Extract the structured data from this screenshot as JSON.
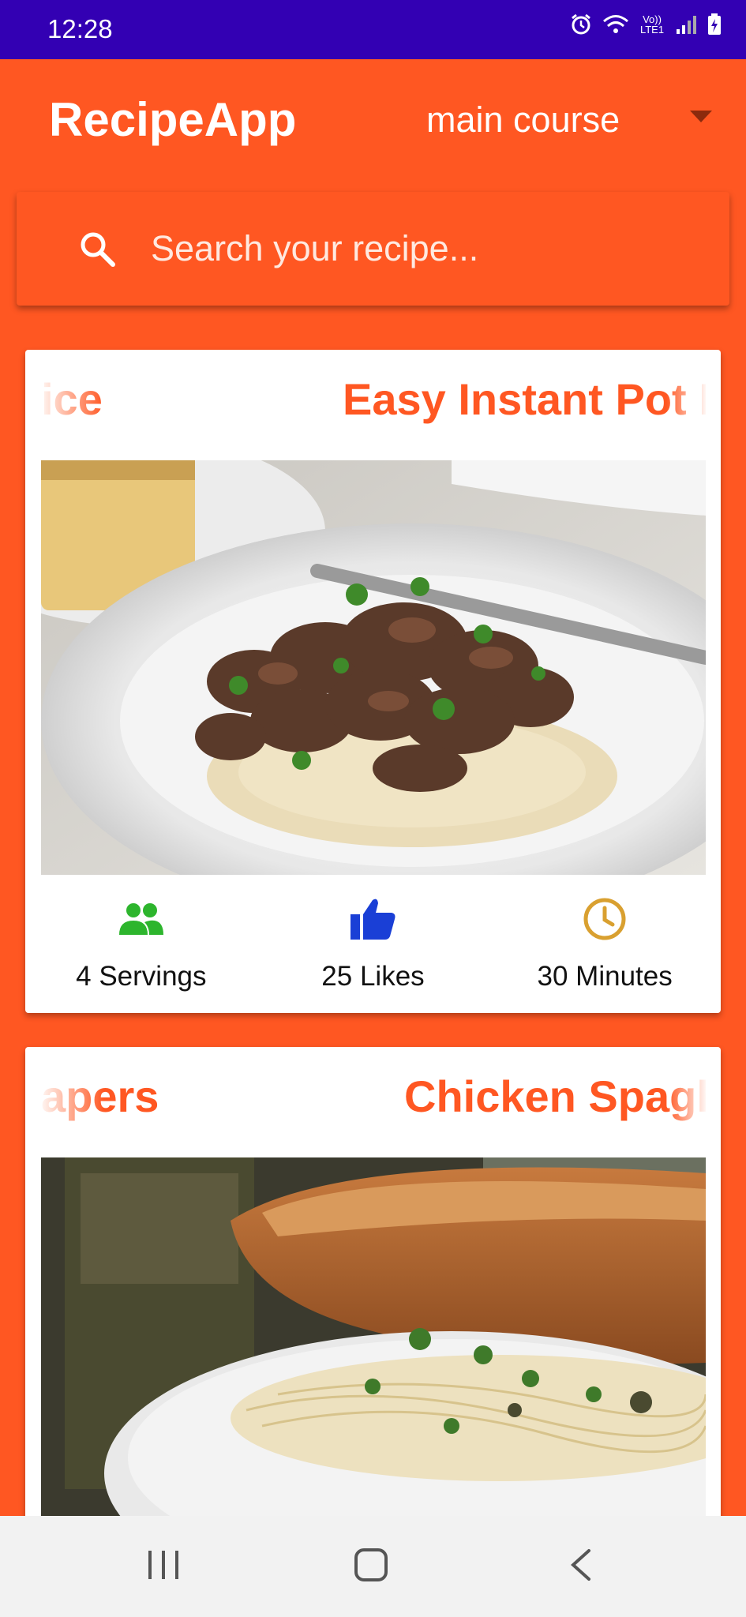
{
  "status_bar": {
    "time": "12:28",
    "network_label": "Vo)) LTE1"
  },
  "app_bar": {
    "title": "RecipeApp",
    "category": "main course"
  },
  "search": {
    "placeholder": "Search your recipe..."
  },
  "recipes": [
    {
      "prev_title_fragment": "ice",
      "title": "Easy Instant Pot Be",
      "servings": "4 Servings",
      "likes": "25 Likes",
      "time": "30 Minutes"
    },
    {
      "prev_title_fragment": "apers",
      "title": "Chicken Spaghe"
    }
  ],
  "colors": {
    "primary": "#FF5722",
    "status_bar": "#3300B3",
    "servings_icon": "#2DB52D",
    "likes_icon": "#1A3FD6",
    "time_icon": "#D9A030"
  }
}
